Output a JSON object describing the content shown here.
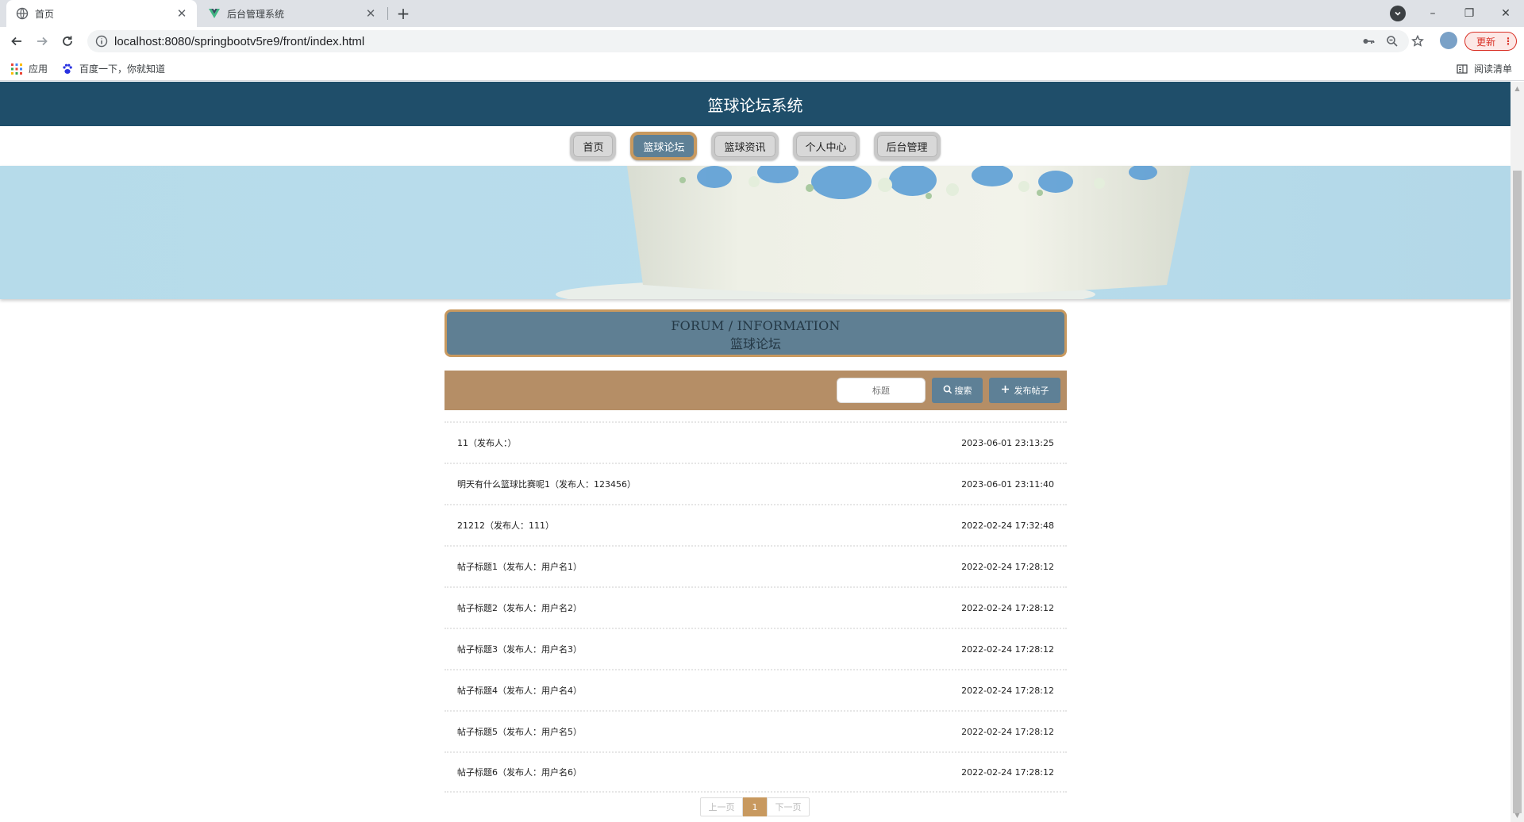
{
  "browser": {
    "tabs": [
      {
        "title": "首页",
        "active": true,
        "icon": "globe-icon"
      },
      {
        "title": "后台管理系统",
        "active": false,
        "icon": "vue-logo-icon"
      }
    ],
    "url": "localhost:8080/springbootv5re9/front/index.html",
    "update_label": "更新",
    "bookmarks": [
      {
        "label": "应用",
        "icon": "apps-grid-icon"
      },
      {
        "label": "百度一下，你就知道",
        "icon": "baidu-paw-icon"
      }
    ],
    "reading_list_label": "阅读清单"
  },
  "site": {
    "title": "篮球论坛系统",
    "nav": [
      {
        "label": "首页",
        "active": false
      },
      {
        "label": "篮球论坛",
        "active": true
      },
      {
        "label": "篮球资讯",
        "active": false
      },
      {
        "label": "个人中心",
        "active": false
      },
      {
        "label": "后台管理",
        "active": false
      }
    ]
  },
  "forum": {
    "subtitle": "FORUM / INFORMATION",
    "title": "篮球论坛",
    "search_placeholder": "标题",
    "search_label": "搜索",
    "post_label": "发布帖子",
    "posts": [
      {
        "title": "11（发布人：）",
        "time": "2023-06-01 23:13:25"
      },
      {
        "title": "明天有什么篮球比赛呢1（发布人：123456）",
        "time": "2023-06-01 23:11:40"
      },
      {
        "title": "21212（发布人：111）",
        "time": "2022-02-24 17:32:48"
      },
      {
        "title": "帖子标题1（发布人：用户名1）",
        "time": "2022-02-24 17:28:12"
      },
      {
        "title": "帖子标题2（发布人：用户名2）",
        "time": "2022-02-24 17:28:12"
      },
      {
        "title": "帖子标题3（发布人：用户名3）",
        "time": "2022-02-24 17:28:12"
      },
      {
        "title": "帖子标题4（发布人：用户名4）",
        "time": "2022-02-24 17:28:12"
      },
      {
        "title": "帖子标题5（发布人：用户名5）",
        "time": "2022-02-24 17:28:12"
      },
      {
        "title": "帖子标题6（发布人：用户名6）",
        "time": "2022-02-24 17:28:12"
      }
    ],
    "pagination": {
      "prev": "上一页",
      "current": "1",
      "next": "下一页"
    }
  },
  "colors": {
    "header_bg": "#1f4e6a",
    "accent_blue": "#5e8096",
    "accent_tan": "#b58e66",
    "border_gold": "#c8995f"
  }
}
